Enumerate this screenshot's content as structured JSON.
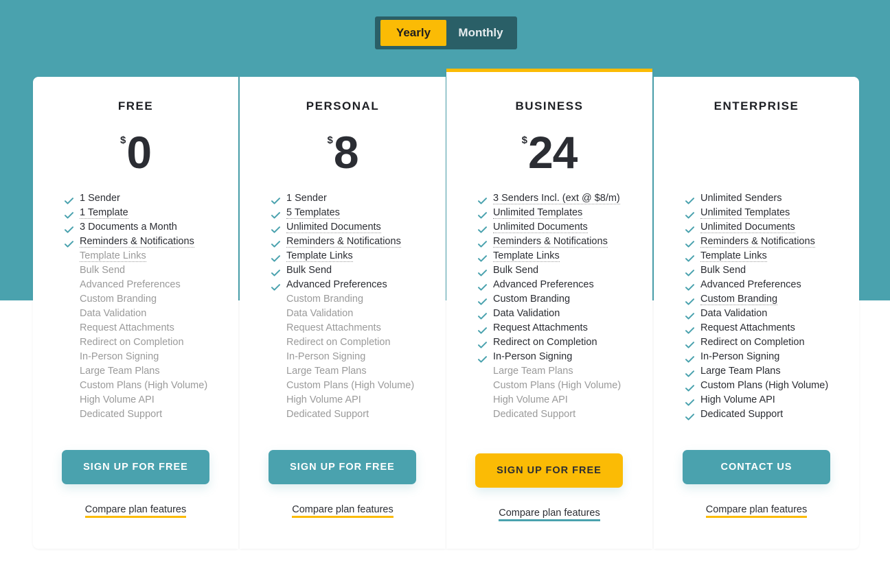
{
  "colors": {
    "teal": "#4aa2ae",
    "teal_dark": "#2a5f67",
    "yellow": "#fbbb05",
    "text": "#2b2d33",
    "muted": "#9a9a9a"
  },
  "billing_toggle": {
    "options": [
      "Yearly",
      "Monthly"
    ],
    "selected": "Yearly"
  },
  "plans": [
    {
      "name": "FREE",
      "currency": "$",
      "price": "0",
      "features": [
        {
          "label": "1 Sender",
          "included": true,
          "tooltip": false
        },
        {
          "label": "1 Template",
          "included": true,
          "tooltip": true
        },
        {
          "label": "3 Documents a Month",
          "included": true,
          "tooltip": false
        },
        {
          "label": "Reminders & Notifications",
          "included": true,
          "tooltip": true
        },
        {
          "label": "Template Links",
          "included": false,
          "tooltip": true
        },
        {
          "label": "Bulk Send",
          "included": false,
          "tooltip": false
        },
        {
          "label": "Advanced Preferences",
          "included": false,
          "tooltip": false
        },
        {
          "label": "Custom Branding",
          "included": false,
          "tooltip": false
        },
        {
          "label": "Data Validation",
          "included": false,
          "tooltip": false
        },
        {
          "label": "Request Attachments",
          "included": false,
          "tooltip": false
        },
        {
          "label": "Redirect on Completion",
          "included": false,
          "tooltip": false
        },
        {
          "label": "In-Person Signing",
          "included": false,
          "tooltip": false
        },
        {
          "label": "Large Team Plans",
          "included": false,
          "tooltip": false
        },
        {
          "label": "Custom Plans (High Volume)",
          "included": false,
          "tooltip": false
        },
        {
          "label": "High Volume API",
          "included": false,
          "tooltip": false
        },
        {
          "label": "Dedicated Support",
          "included": false,
          "tooltip": false
        }
      ],
      "cta": "SIGN UP FOR FREE",
      "cta_style": "teal",
      "compare_link": "Compare plan features"
    },
    {
      "name": "PERSONAL",
      "currency": "$",
      "price": "8",
      "features": [
        {
          "label": "1 Sender",
          "included": true,
          "tooltip": false
        },
        {
          "label": "5 Templates",
          "included": true,
          "tooltip": true
        },
        {
          "label": "Unlimited Documents",
          "included": true,
          "tooltip": true
        },
        {
          "label": "Reminders & Notifications",
          "included": true,
          "tooltip": true
        },
        {
          "label": "Template Links",
          "included": true,
          "tooltip": true
        },
        {
          "label": "Bulk Send",
          "included": true,
          "tooltip": false
        },
        {
          "label": "Advanced Preferences",
          "included": true,
          "tooltip": false
        },
        {
          "label": "Custom Branding",
          "included": false,
          "tooltip": false
        },
        {
          "label": "Data Validation",
          "included": false,
          "tooltip": false
        },
        {
          "label": "Request Attachments",
          "included": false,
          "tooltip": false
        },
        {
          "label": "Redirect on Completion",
          "included": false,
          "tooltip": false
        },
        {
          "label": "In-Person Signing",
          "included": false,
          "tooltip": false
        },
        {
          "label": "Large Team Plans",
          "included": false,
          "tooltip": false
        },
        {
          "label": "Custom Plans (High Volume)",
          "included": false,
          "tooltip": false
        },
        {
          "label": "High Volume API",
          "included": false,
          "tooltip": false
        },
        {
          "label": "Dedicated Support",
          "included": false,
          "tooltip": false
        }
      ],
      "cta": "SIGN UP FOR FREE",
      "cta_style": "teal",
      "compare_link": "Compare plan features"
    },
    {
      "name": "BUSINESS",
      "currency": "$",
      "price": "24",
      "highlighted": true,
      "features": [
        {
          "label": "3 Senders Incl. (ext @ $8/m)",
          "included": true,
          "tooltip": true
        },
        {
          "label": "Unlimited Templates",
          "included": true,
          "tooltip": true
        },
        {
          "label": "Unlimited Documents",
          "included": true,
          "tooltip": true
        },
        {
          "label": "Reminders & Notifications",
          "included": true,
          "tooltip": true
        },
        {
          "label": "Template Links",
          "included": true,
          "tooltip": true
        },
        {
          "label": "Bulk Send",
          "included": true,
          "tooltip": false
        },
        {
          "label": "Advanced Preferences",
          "included": true,
          "tooltip": false
        },
        {
          "label": "Custom Branding",
          "included": true,
          "tooltip": false
        },
        {
          "label": "Data Validation",
          "included": true,
          "tooltip": false
        },
        {
          "label": "Request Attachments",
          "included": true,
          "tooltip": false
        },
        {
          "label": "Redirect on Completion",
          "included": true,
          "tooltip": false
        },
        {
          "label": "In-Person Signing",
          "included": true,
          "tooltip": false
        },
        {
          "label": "Large Team Plans",
          "included": false,
          "tooltip": false
        },
        {
          "label": "Custom Plans (High Volume)",
          "included": false,
          "tooltip": false
        },
        {
          "label": "High Volume API",
          "included": false,
          "tooltip": false
        },
        {
          "label": "Dedicated Support",
          "included": false,
          "tooltip": false
        }
      ],
      "cta": "SIGN UP FOR FREE",
      "cta_style": "yellow",
      "compare_link": "Compare plan features"
    },
    {
      "name": "ENTERPRISE",
      "currency": "",
      "price": "",
      "features": [
        {
          "label": "Unlimited Senders",
          "included": true,
          "tooltip": false
        },
        {
          "label": "Unlimited Templates",
          "included": true,
          "tooltip": true
        },
        {
          "label": "Unlimited Documents",
          "included": true,
          "tooltip": true
        },
        {
          "label": "Reminders & Notifications",
          "included": true,
          "tooltip": true
        },
        {
          "label": "Template Links",
          "included": true,
          "tooltip": true
        },
        {
          "label": "Bulk Send",
          "included": true,
          "tooltip": false
        },
        {
          "label": "Advanced Preferences",
          "included": true,
          "tooltip": false
        },
        {
          "label": "Custom Branding",
          "included": true,
          "tooltip": true
        },
        {
          "label": "Data Validation",
          "included": true,
          "tooltip": false
        },
        {
          "label": "Request Attachments",
          "included": true,
          "tooltip": false
        },
        {
          "label": "Redirect on Completion",
          "included": true,
          "tooltip": false
        },
        {
          "label": "In-Person Signing",
          "included": true,
          "tooltip": false
        },
        {
          "label": "Large Team Plans",
          "included": true,
          "tooltip": false
        },
        {
          "label": "Custom Plans (High Volume)",
          "included": true,
          "tooltip": false
        },
        {
          "label": "High Volume API",
          "included": true,
          "tooltip": false
        },
        {
          "label": "Dedicated Support",
          "included": true,
          "tooltip": false
        }
      ],
      "cta": "CONTACT US",
      "cta_style": "teal",
      "compare_link": "Compare plan features"
    }
  ]
}
